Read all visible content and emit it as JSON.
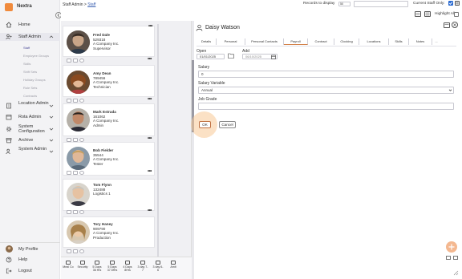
{
  "app": {
    "name": "Nextra"
  },
  "sidebar": {
    "home": "Home",
    "staff_admin": "Staff Admin",
    "staff_sub": [
      "Staff",
      "Employee Groups",
      "Skills",
      "Shift Sets",
      "Holiday Groups",
      "Role Sets",
      "Contracts"
    ],
    "location_admin": "Location Admin",
    "rota_admin": "Rota Admin",
    "system_configuration": "System Configuration",
    "archive": "Archive",
    "system_admin": "System Admin",
    "my_profile": "My Profile",
    "help": "Help",
    "logout": "Logout"
  },
  "topbar": {
    "breadcrumb_root": "Staff Admin",
    "breadcrumb_sep": " > ",
    "breadcrumb_current": "Staff",
    "records_label": "Records to display",
    "records_value": "50",
    "search_placeholder": "",
    "current_staff_label": "Current Staff Only:",
    "current_staff_checked": true,
    "highlight_label": "Highlight All"
  },
  "staff": [
    {
      "name": "Fred Dale",
      "id": "529318",
      "company": "A Company Inc.",
      "role": "Supervisor"
    },
    {
      "name": "Amy Dean",
      "id": "789456",
      "company": "A Company Inc.",
      "role": "Technician"
    },
    {
      "name": "Mark Estrada",
      "id": "161062",
      "company": "A Company Inc.",
      "role": "Admin"
    },
    {
      "name": "Bob Fielder",
      "id": "35544",
      "company": "A Company Inc.",
      "role": "Tester"
    },
    {
      "name": "Tom Flynn",
      "id": "132488",
      "company": "Logistics 1",
      "role": ""
    },
    {
      "name": "Tory Haney",
      "id": "909790",
      "company": "A Company Inc.",
      "role": "Production"
    }
  ],
  "bottom_bar": [
    {
      "l1": "Meal Co",
      "l2": ""
    },
    {
      "l1": "Security",
      "l2": ""
    },
    {
      "l1": "5 Days",
      "l2": "36 Hrs"
    },
    {
      "l1": "5 Days",
      "l2": "37.5Hrs"
    },
    {
      "l1": "4 Days",
      "l2": "8Hrs"
    },
    {
      "l1": "3 day 7-",
      "l2": "7"
    },
    {
      "l1": "3 day 6-",
      "l2": "6"
    },
    {
      "l1": "Amit",
      "l2": ""
    }
  ],
  "detail": {
    "person_name": "Daisy Watson",
    "tabs": [
      "Details",
      "Personal",
      "Personal Contacts",
      "Payroll",
      "Contract",
      "Clocking",
      "Locations",
      "Skills",
      "Notes",
      "..."
    ],
    "active_tab": "Payroll",
    "open_label": "Open",
    "open_value": "01/01/2025",
    "add_label": "Add",
    "add_value": "06/10/2025",
    "salary_label": "Salary",
    "salary_value": "0",
    "salary_variable_label": "Salary Variable",
    "salary_variable_value": "Annual",
    "job_grade_label": "Job Grade",
    "job_grade_value": "",
    "ok_label": "OK",
    "cancel_label": "Cancel"
  },
  "colors": {
    "accent": "#f08a3c",
    "link": "#3a5fb0",
    "sidebar_bg": "#f3f3f5",
    "active_sub": "#4c4c99"
  }
}
